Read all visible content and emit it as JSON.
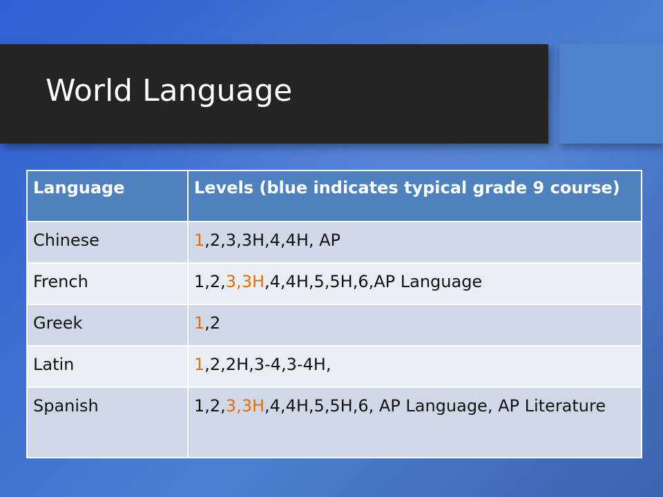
{
  "slide": {
    "title": "World Language",
    "colors": {
      "background": "#3f6fcf",
      "title_bar": "#242424",
      "accent_block": "#4f82c8",
      "header_row": "#4f81bd",
      "row_odd": "#d0d8e8",
      "row_even": "#e9edf4",
      "highlight": "#e46c0a"
    }
  },
  "table": {
    "headers": [
      "Language",
      "Levels (blue indicates typical grade 9 course)"
    ],
    "rows": [
      {
        "language": "Chinese",
        "levels": [
          {
            "text": "1",
            "highlight": true
          },
          {
            "text": ",2,3,3H,4,4H, AP",
            "highlight": false
          }
        ]
      },
      {
        "language": "French",
        "levels": [
          {
            "text": "1,2,",
            "highlight": false
          },
          {
            "text": "3,3H",
            "highlight": true
          },
          {
            "text": ",4,4H,5,5H,6,AP Language",
            "highlight": false
          }
        ]
      },
      {
        "language": "Greek",
        "levels": [
          {
            "text": "1",
            "highlight": true
          },
          {
            "text": ",2",
            "highlight": false
          }
        ]
      },
      {
        "language": "Latin",
        "levels": [
          {
            "text": "1",
            "highlight": true
          },
          {
            "text": ",2,2H,3-4,3-4H,",
            "highlight": false
          }
        ]
      },
      {
        "language": "Spanish",
        "levels": [
          {
            "text": "1,2,",
            "highlight": false
          },
          {
            "text": "3,3H",
            "highlight": true
          },
          {
            "text": ",4,4H,5,5H,6, AP Language, AP Literature",
            "highlight": false
          }
        ]
      }
    ]
  }
}
